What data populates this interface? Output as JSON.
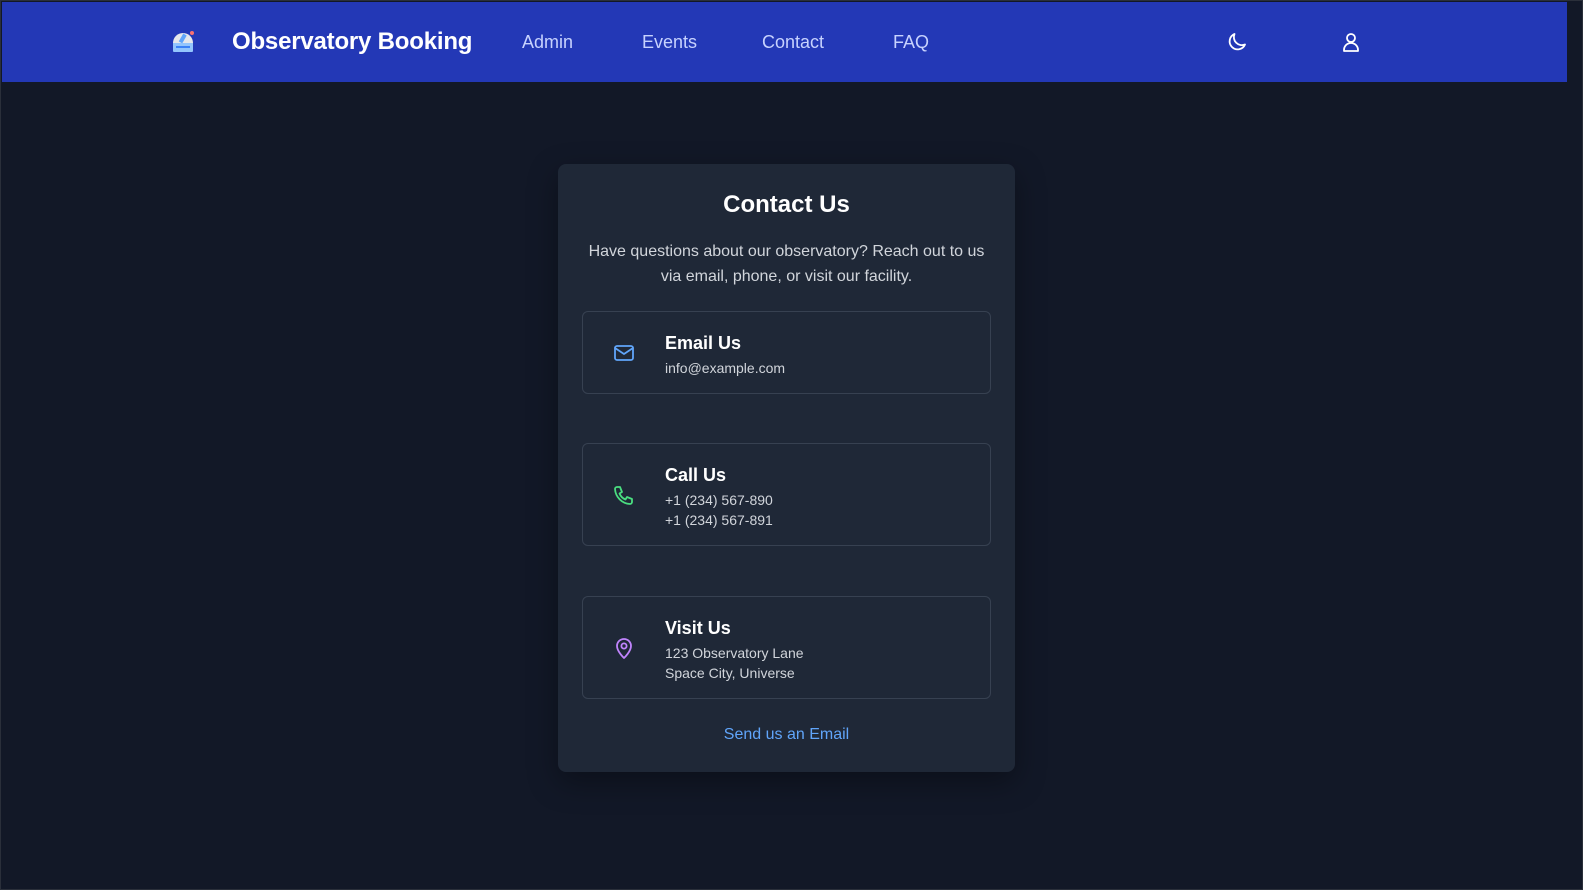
{
  "app": {
    "brand": "Observatory Booking",
    "logo_icon": "observatory-dome-icon"
  },
  "nav": {
    "items": [
      {
        "label": "Admin"
      },
      {
        "label": "Events"
      },
      {
        "label": "Contact"
      },
      {
        "label": "FAQ"
      }
    ],
    "theme_toggle_icon": "moon-icon",
    "user_icon": "user-icon"
  },
  "contact": {
    "title": "Contact Us",
    "description": "Have questions about our observatory? Reach out to us via email, phone, or visit our facility.",
    "email": {
      "icon": "mail-icon",
      "heading": "Email Us",
      "lines": [
        "info@example.com"
      ]
    },
    "call": {
      "icon": "phone-icon",
      "heading": "Call Us",
      "lines": [
        "+1 (234) 567-890",
        "+1 (234) 567-891"
      ]
    },
    "visit": {
      "icon": "map-pin-icon",
      "heading": "Visit Us",
      "lines": [
        "123 Observatory Lane",
        "Space City, Universe"
      ]
    },
    "send_link": "Send us an Email"
  },
  "colors": {
    "navbar": "#2338b6",
    "page_bg": "#121827",
    "card_bg": "#1f2837",
    "email_accent": "#60a5fa",
    "phone_accent": "#4ade80",
    "visit_accent": "#c084fc",
    "link": "#60a5fa"
  }
}
